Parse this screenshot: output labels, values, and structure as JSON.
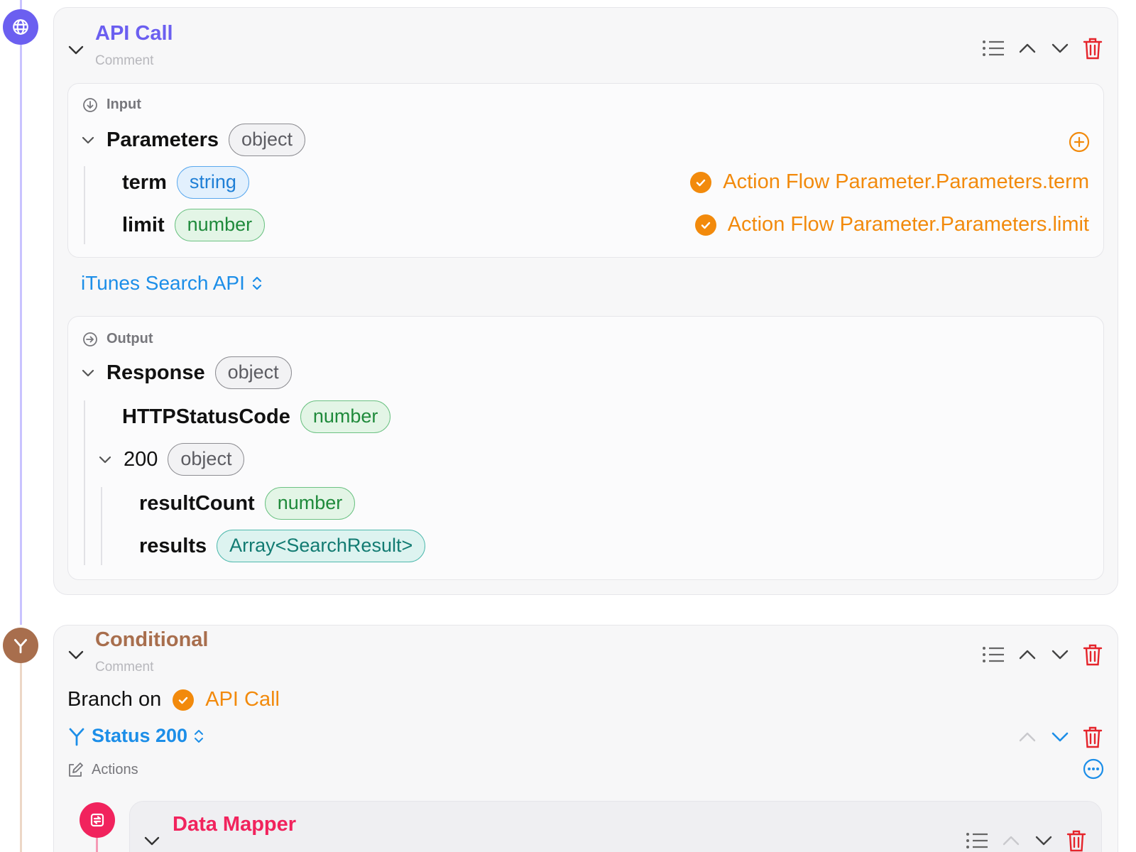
{
  "api_call": {
    "title": "API Call",
    "comment_placeholder": "Comment",
    "input": {
      "heading": "Input",
      "group_name": "Parameters",
      "group_type": "object",
      "fields": [
        {
          "name": "term",
          "type": "string",
          "binding": "Action Flow Parameter.Parameters.term"
        },
        {
          "name": "limit",
          "type": "number",
          "binding": "Action Flow Parameter.Parameters.limit"
        }
      ]
    },
    "endpoint": "iTunes Search API",
    "output": {
      "heading": "Output",
      "group_name": "Response",
      "group_type": "object",
      "status_field": {
        "name": "HTTPStatusCode",
        "type": "number"
      },
      "code_group": {
        "name": "200",
        "type": "object"
      },
      "code_fields": [
        {
          "name": "resultCount",
          "type": "number"
        },
        {
          "name": "results",
          "type": "Array<SearchResult>"
        }
      ]
    }
  },
  "conditional": {
    "title": "Conditional",
    "comment_placeholder": "Comment",
    "branch_label": "Branch on",
    "branch_ref": "API Call",
    "status_option": "Status 200",
    "actions_label": "Actions"
  },
  "data_mapper": {
    "title": "Data Mapper"
  },
  "colors": {
    "api_call": "#6b5ff0",
    "conditional": "#a86e4d",
    "data_mapper": "#f1235d",
    "binding": "#f28a0c",
    "link": "#1c8ee8",
    "delete": "#e5242b"
  }
}
